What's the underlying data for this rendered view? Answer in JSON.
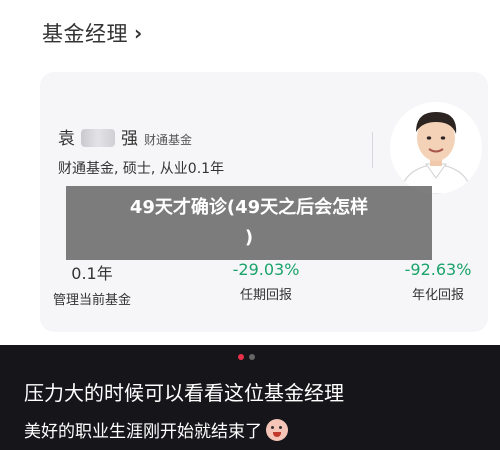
{
  "header": {
    "title": "基金经理",
    "chevron": "›"
  },
  "manager": {
    "name_start": "袁",
    "name_end": "强",
    "company": "财通基金",
    "details": "财通基金, 硕士, 从业0.1年"
  },
  "stats": [
    {
      "value": "0.1年",
      "label": "管理当前基金",
      "tone": "neutral"
    },
    {
      "value": "-29.03%",
      "label": "任期回报",
      "tone": "green"
    },
    {
      "value": "-92.63%",
      "label": "年化回报",
      "tone": "green"
    }
  ],
  "overlay": {
    "line1": "49天才确诊(49天之后会怎样",
    "line2": ")"
  },
  "carousel": {
    "pages": 2,
    "active": 1
  },
  "captions": {
    "line1": "压力大的时候可以看看这位基金经理",
    "line2": "美好的职业生涯刚开始就结束了"
  },
  "colors": {
    "negative": "#1aa36b",
    "dot_active": "#e8304a",
    "bottom_bg": "#16161a"
  }
}
